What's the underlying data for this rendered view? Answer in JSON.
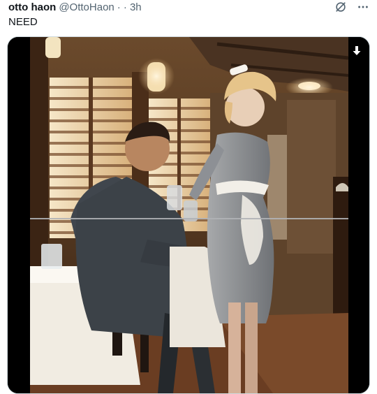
{
  "tweet": {
    "author_name": "otto haon",
    "handle": "@OttoHaon",
    "separator": "· ·",
    "timestamp": "3h",
    "text": "NEED"
  },
  "icons": {
    "no_translate": "slashed-circle-icon",
    "more": "more-horizontal-icon",
    "download": "download-arrow-icon"
  },
  "colors": {
    "name": "#0f1419",
    "secondary": "#536471",
    "media_border": "#cfd9de"
  }
}
